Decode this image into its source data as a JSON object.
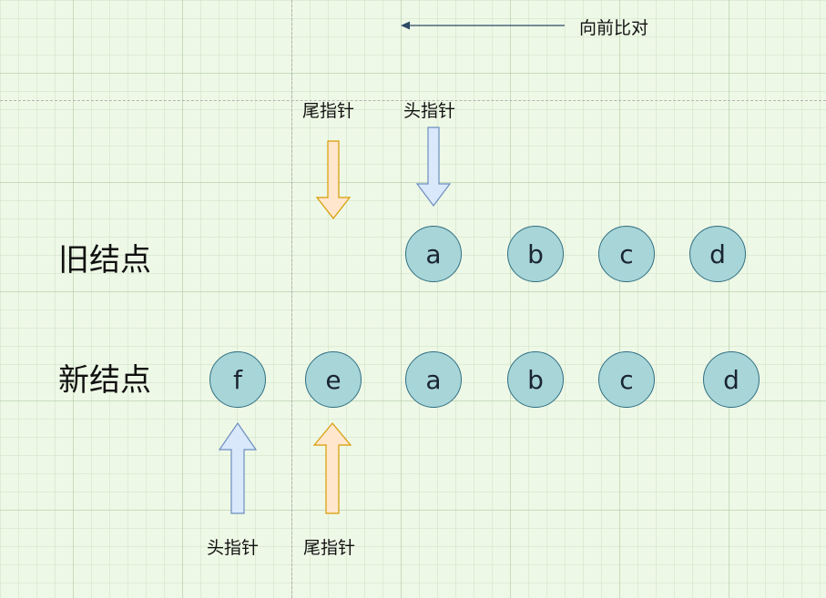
{
  "compare_direction_label": "向前比对",
  "rows": {
    "old_label": "旧结点",
    "new_label": "新结点"
  },
  "old_nodes": [
    "a",
    "b",
    "c",
    "d"
  ],
  "new_nodes": [
    "f",
    "e",
    "a",
    "b",
    "c",
    "d"
  ],
  "pointers": {
    "old_tail": "尾指针",
    "old_head": "头指针",
    "new_head": "头指针",
    "new_tail": "尾指针"
  },
  "colors": {
    "node_fill": "#a8d5d8",
    "node_stroke": "#2f6f82",
    "head_arrow_fill": "#dae8fc",
    "head_arrow_stroke": "#6c8ebf",
    "tail_arrow_fill": "#ffe6cc",
    "tail_arrow_stroke": "#d79b00"
  }
}
